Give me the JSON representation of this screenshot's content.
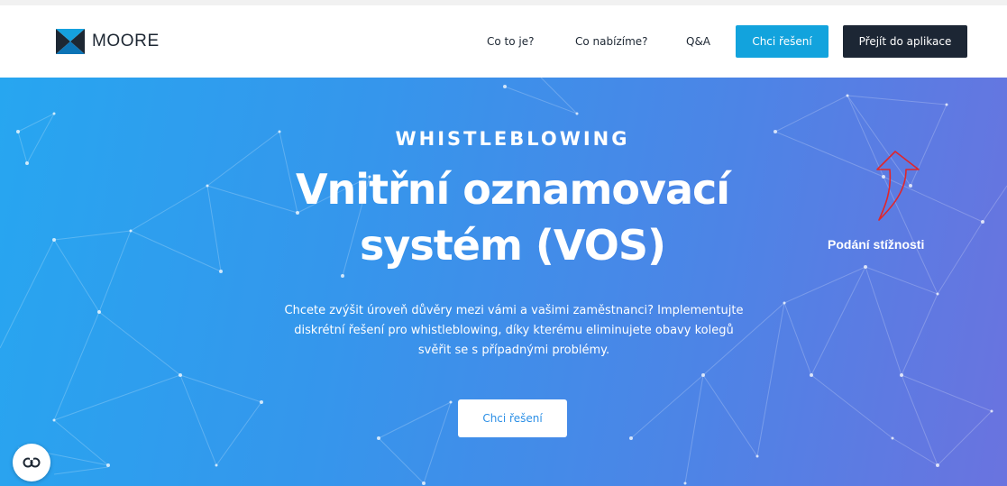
{
  "brand": {
    "name": "MOORE",
    "logo_icon": "moore-logo-icon"
  },
  "nav": {
    "items": [
      {
        "label": "Co to je?"
      },
      {
        "label": "Co nabízíme?"
      },
      {
        "label": "Q&A"
      }
    ],
    "cta_primary": "Chci řešení",
    "cta_app": "Přejít do aplikace"
  },
  "hero": {
    "eyebrow": "WHISTLEBLOWING",
    "title_line1": "Vnitřní oznamovací",
    "title_line2": "systém (VOS)",
    "lead_line1": "Chcete zvýšit úroveň důvěry mezi vámi a vašimi zaměstnanci? Implementujte",
    "lead_line2": "diskrétní řešení pro whistleblowing, díky kterému eliminujete obavy kolegů",
    "lead_line3": "svěřit se s případnými problémy.",
    "cta": "Chci řešení"
  },
  "annotation": {
    "text": "Podání stížnosti",
    "arrow_icon": "arrow-up-outline-icon",
    "color": "#e0262b"
  },
  "cookie": {
    "icon": "cookie-settings-icon",
    "glyph": "CO"
  },
  "colors": {
    "accent_blue": "#12a3dd",
    "dark": "#1c2634",
    "hero_start": "#27a6f0",
    "hero_end": "#6a73df"
  }
}
